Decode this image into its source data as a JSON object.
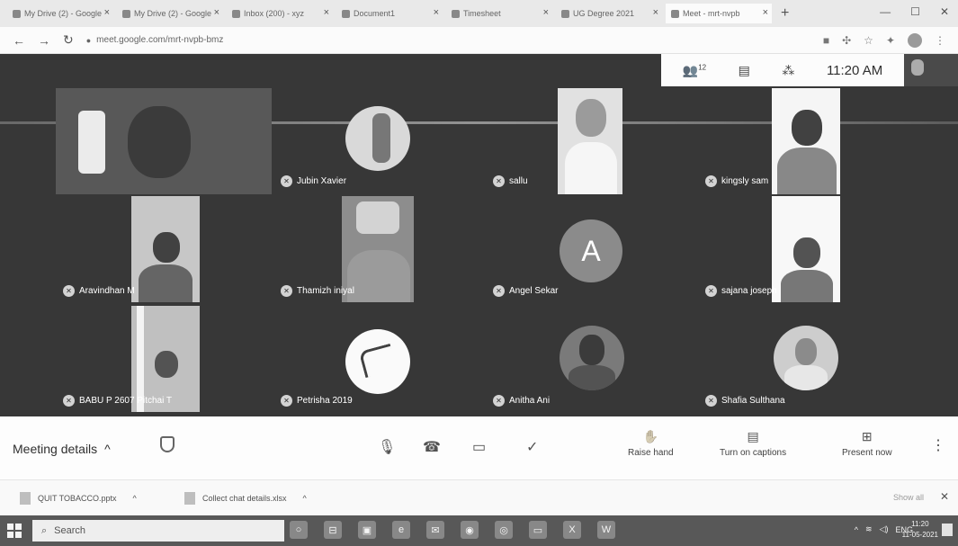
{
  "browser": {
    "tabs": [
      {
        "title": "My Drive (2) - Google"
      },
      {
        "title": "My Drive (2) - Google"
      },
      {
        "title": "Inbox (200) - xyz"
      },
      {
        "title": "Document1"
      },
      {
        "title": "Timesheet"
      },
      {
        "title": "UG Degree 2021"
      },
      {
        "title": "Meet - mrt-nvpb"
      }
    ],
    "new_tab_label": "+",
    "url": "meet.google.com/mrt-nvpb-bmz",
    "window_controls": [
      "—",
      "☐",
      "✕"
    ]
  },
  "meet": {
    "clock": "11:20 AM",
    "top_icons": [
      "people-icon",
      "chat-icon",
      "activities-icon"
    ],
    "people_count": "12",
    "participants": [
      {
        "name": ""
      },
      {
        "name": "Jubin Xavier"
      },
      {
        "name": "sallu"
      },
      {
        "name": "kingsly sam"
      },
      {
        "name": "Aravindhan M"
      },
      {
        "name": "Thamizh iniyal"
      },
      {
        "name": "Angel Sekar",
        "initial": "A"
      },
      {
        "name": "sajana joseph"
      },
      {
        "name": "BABU P 2607 Pitchai T"
      },
      {
        "name": "Petrisha 2019"
      },
      {
        "name": "Anitha Ani"
      },
      {
        "name": "Shafia Sulthana"
      }
    ]
  },
  "controls": {
    "meeting_details": "Meeting details",
    "raise_hand": "Raise hand",
    "captions": "Turn on captions",
    "present": "Present now"
  },
  "downloads": {
    "items": [
      "QUIT TOBACCO.pptx",
      "Collect chat details.xlsx"
    ],
    "show_all": "Show all"
  },
  "taskbar": {
    "search_placeholder": "Search",
    "lang": "ENG",
    "time": "11:20",
    "date": "11-05-2021"
  }
}
